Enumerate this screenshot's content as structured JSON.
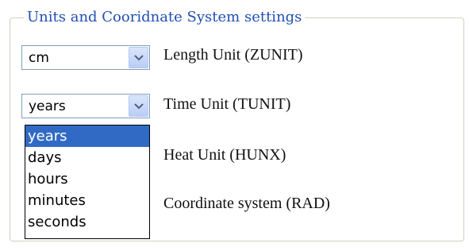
{
  "group": {
    "title": "Units and Cooridnate System settings"
  },
  "length_unit": {
    "label": "Length Unit (ZUNIT)",
    "value": "cm"
  },
  "time_unit": {
    "label": "Time Unit (TUNIT)",
    "value": "years",
    "options": [
      "years",
      "days",
      "hours",
      "minutes",
      "seconds"
    ],
    "selected_index": 0
  },
  "heat_unit": {
    "label": "Heat Unit (HUNX)"
  },
  "coordinate_system": {
    "label": "Coordinate system (RAD)"
  },
  "colors": {
    "legend_text": "#1f4fb5",
    "group_border": "#d0d0bf",
    "combo_border": "#7f9db9",
    "selection_background": "#316ac5"
  },
  "icons": {
    "combo_button": "chevron-down-icon"
  }
}
